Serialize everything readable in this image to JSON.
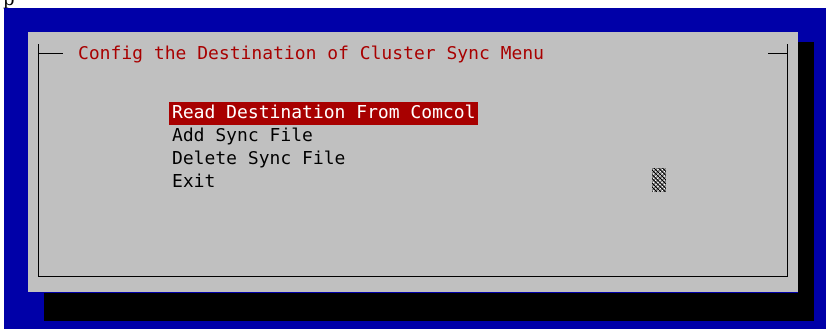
{
  "top_text": "p",
  "dialog": {
    "title": "Config the Destination of Cluster Sync Menu",
    "menu_items": [
      {
        "label": "Read Destination From Comcol",
        "selected": true
      },
      {
        "label": "Add Sync File",
        "selected": false
      },
      {
        "label": "Delete Sync File",
        "selected": false
      },
      {
        "label": "Exit",
        "selected": false
      }
    ]
  },
  "colors": {
    "terminal_background": "#0000a8",
    "dialog_background": "#c0c0c0",
    "title_text": "#a80000",
    "selection_background": "#a80000",
    "selection_text": "#ffffff",
    "shadow": "#000000"
  }
}
